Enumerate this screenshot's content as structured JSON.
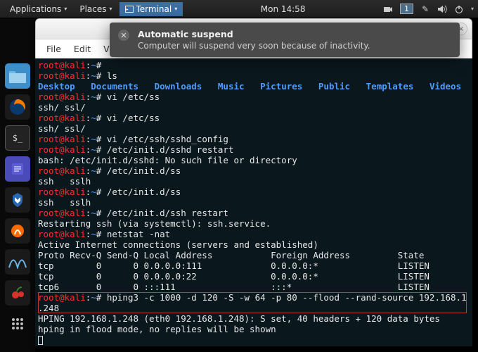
{
  "topbar": {
    "applications": "Applications",
    "places": "Places",
    "terminal": "Terminal",
    "clock": "Mon 14:58",
    "workspace": "1"
  },
  "notification": {
    "title": "Automatic suspend",
    "body": "Computer will suspend very soon because of inactivity."
  },
  "menubar": {
    "file": "File",
    "edit": "Edit",
    "view": "View"
  },
  "dock": {
    "items": [
      "files",
      "firefox",
      "terminal",
      "gedit",
      "metasploit",
      "burp",
      "wireshark",
      "cherrytree",
      "apps"
    ]
  },
  "terminal": {
    "prompt_user": "root",
    "prompt_host": "kali",
    "prompt_path": "~",
    "lines": [
      {
        "type": "prompt",
        "cmd": ""
      },
      {
        "type": "prompt",
        "cmd": "ls"
      },
      {
        "type": "folders",
        "items": [
          "Desktop",
          "Documents",
          "Downloads",
          "Music",
          "Pictures",
          "Public",
          "Templates",
          "Videos"
        ]
      },
      {
        "type": "prompt",
        "cmd": "vi /etc/ss"
      },
      {
        "type": "text",
        "text": "ssh/ ssl/"
      },
      {
        "type": "prompt",
        "cmd": "vi /etc/ss"
      },
      {
        "type": "text",
        "text": "ssh/ ssl/"
      },
      {
        "type": "prompt",
        "cmd": "vi /etc/ssh/sshd_config"
      },
      {
        "type": "prompt",
        "cmd": "/etc/init.d/sshd restart"
      },
      {
        "type": "text",
        "text": "bash: /etc/init.d/sshd: No such file or directory"
      },
      {
        "type": "prompt",
        "cmd": "/etc/init.d/ss"
      },
      {
        "type": "text",
        "text": "ssh   sslh"
      },
      {
        "type": "prompt",
        "cmd": "/etc/init.d/ss"
      },
      {
        "type": "text",
        "text": "ssh   sslh"
      },
      {
        "type": "prompt",
        "cmd": "/etc/init.d/ssh restart"
      },
      {
        "type": "text",
        "text": "Restarting ssh (via systemctl): ssh.service."
      },
      {
        "type": "prompt",
        "cmd": "netstat -nat"
      },
      {
        "type": "text",
        "text": "Active Internet connections (servers and established)"
      },
      {
        "type": "text",
        "text": "Proto Recv-Q Send-Q Local Address           Foreign Address         State"
      },
      {
        "type": "text",
        "text": "tcp        0      0 0.0.0.0:111             0.0.0.0:*               LISTEN"
      },
      {
        "type": "text",
        "text": "tcp        0      0 0.0.0.0:22              0.0.0.0:*               LISTEN"
      },
      {
        "type": "text",
        "text": "tcp6       0      0 :::111                  :::*                    LISTEN"
      },
      {
        "type": "prompt",
        "cmd": "hping3 -c 1000 -d 120 -S -w 64 -p 80 --flood --rand-source 192.168.1"
      },
      {
        "type": "text",
        "text": ".248"
      },
      {
        "type": "text",
        "text": "HPING 192.168.1.248 (eth0 192.168.1.248): S set, 40 headers + 120 data bytes"
      },
      {
        "type": "text",
        "text": "hping in flood mode, no replies will be shown"
      }
    ]
  }
}
